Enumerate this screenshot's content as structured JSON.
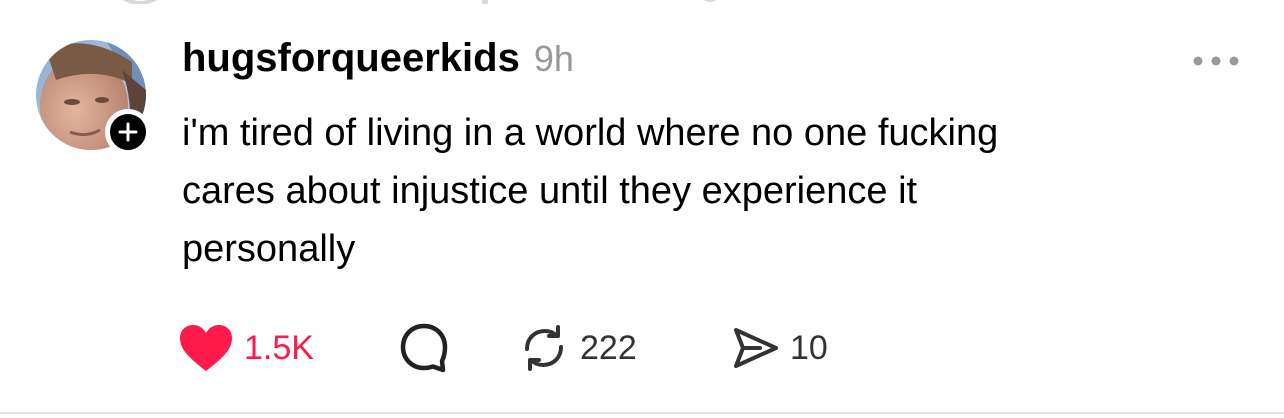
{
  "post": {
    "username": "hugsforqueerkids",
    "timestamp": "9h",
    "text_lines": [
      "i'm tired of living in a world where no one fucking",
      "cares about injustice until they experience it",
      "personally"
    ],
    "likes": "1.5K",
    "reposts": "222",
    "shares": "10",
    "liked": true
  },
  "colors": {
    "like_red": "#ff1a4b",
    "timestamp_gray": "#999999",
    "icon_dark": "#222222"
  },
  "icons": {
    "more": "more-horizontal-icon",
    "like": "heart-filled-icon",
    "reply": "speech-bubble-icon",
    "repost": "repost-arrows-icon",
    "share": "send-arrow-icon",
    "follow": "plus-icon"
  }
}
